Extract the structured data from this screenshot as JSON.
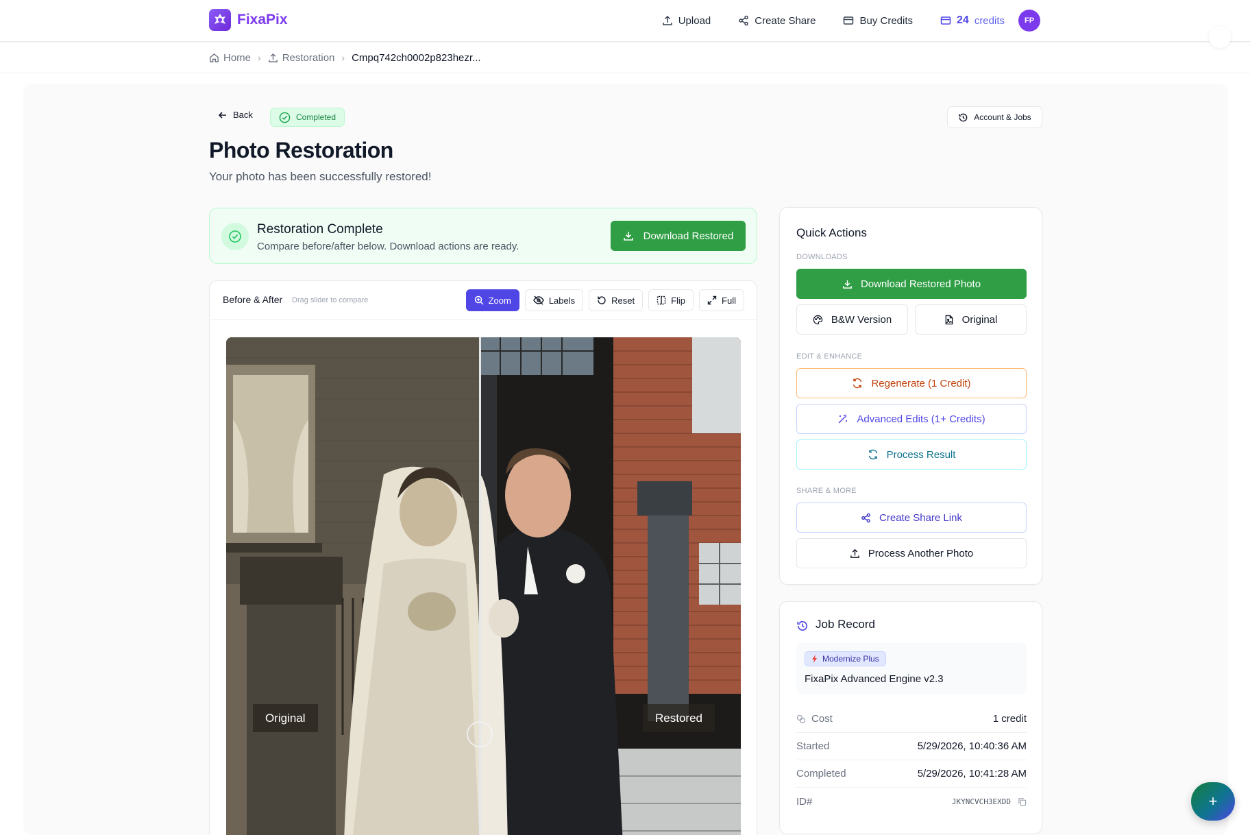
{
  "brand": {
    "name": "FixaPix"
  },
  "nav": {
    "upload": "Upload",
    "create_share": "Create Share",
    "buy_credits": "Buy Credits",
    "credits_count": "24",
    "credits_label": "credits",
    "avatar_initials": "FP"
  },
  "breadcrumb": {
    "home": "Home",
    "restoration": "Restoration",
    "current": "Cmpq742ch0002p823hezr..."
  },
  "header": {
    "back": "Back",
    "status": "Completed",
    "account_jobs": "Account & Jobs",
    "title": "Photo Restoration",
    "subtitle": "Your photo has been successfully restored!"
  },
  "banner": {
    "title": "Restoration Complete",
    "subtitle": "Compare before/after below. Download actions are ready.",
    "button": "Download Restored"
  },
  "compare": {
    "title": "Before & After",
    "hint": "Drag slider to compare",
    "tools": {
      "zoom": "Zoom",
      "labels": "Labels",
      "reset": "Reset",
      "flip": "Flip",
      "full": "Full"
    },
    "label_original": "Original",
    "label_restored": "Restored"
  },
  "quick_actions": {
    "title": "Quick Actions",
    "downloads_label": "Downloads",
    "download_restored": "Download Restored Photo",
    "bw_version": "B&W Version",
    "original": "Original",
    "edit_label": "Edit & Enhance",
    "regenerate": "Regenerate (1 Credit)",
    "advanced_edits": "Advanced Edits (1+ Credits)",
    "process_result": "Process Result",
    "share_label": "Share & More",
    "create_share_link": "Create Share Link",
    "process_another": "Process Another Photo"
  },
  "job_record": {
    "title": "Job Record",
    "tier": "Modernize Plus",
    "engine": "FixaPix Advanced Engine v2.3",
    "rows": [
      {
        "key": "Cost",
        "value": "1 credit"
      },
      {
        "key": "Started",
        "value": "5/29/2026, 10:40:36 AM"
      },
      {
        "key": "Completed",
        "value": "5/29/2026, 10:41:28 AM"
      },
      {
        "key": "ID#",
        "value": "JKYNCVCH3EXDD"
      }
    ]
  },
  "fab": {
    "label": "+"
  },
  "colors": {
    "brand": "#7c3aed",
    "accent": "#4f46e5",
    "success": "#2f9e44"
  }
}
